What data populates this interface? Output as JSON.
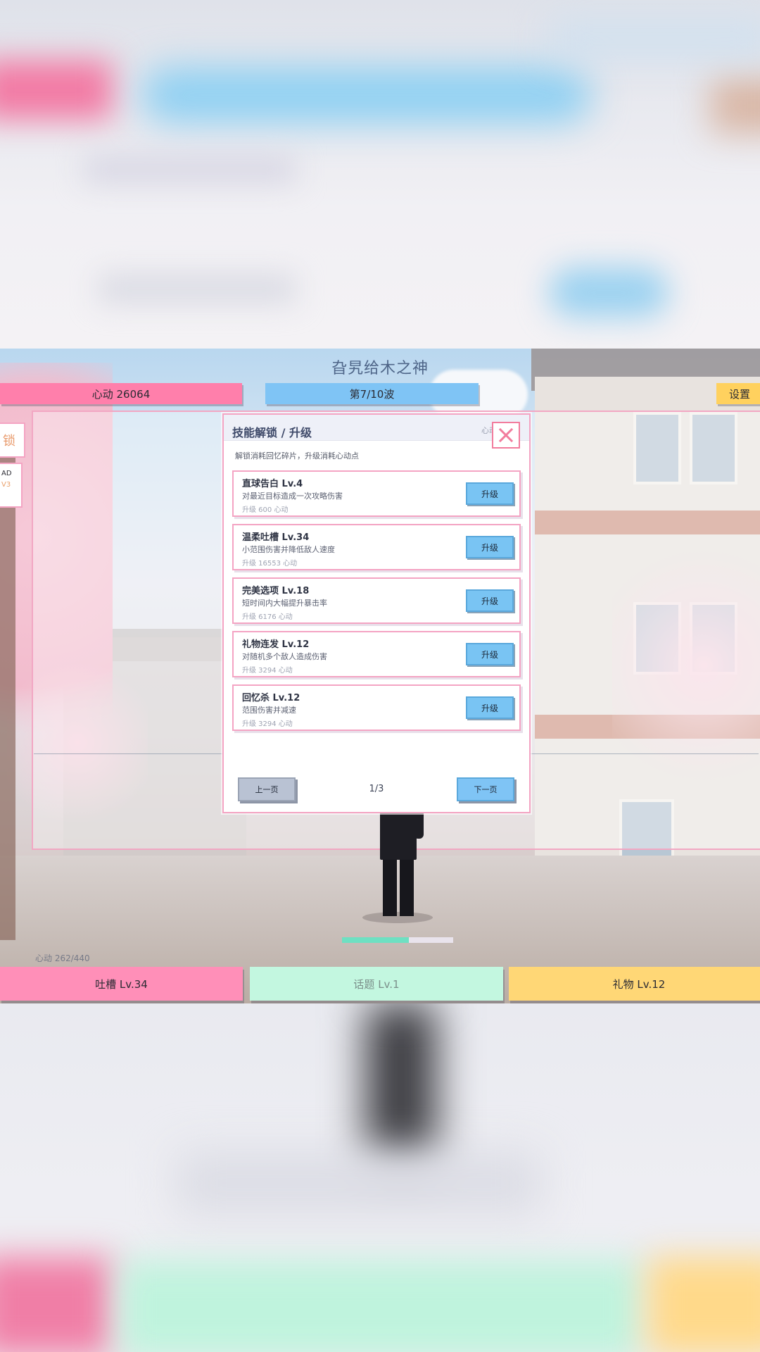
{
  "game": {
    "title": "旮旯给木之神",
    "heart_bar": "心动 26064",
    "wave_bar": "第7/10波",
    "settings_label": "设置",
    "side_tab_label": "锁",
    "side_card_line1": "AD",
    "side_card_line2": "V3",
    "hp_text": "心动 262/440",
    "wave_progress": 0.6,
    "bottom_tabs": {
      "tucao": "吐槽 Lv.34",
      "topic": "话题 Lv.1",
      "gift": "礼物 Lv.12"
    }
  },
  "dialog": {
    "title": "技能解锁 / 升级",
    "hint": "心动",
    "subtitle": "解锁消耗回忆碎片，升级消耗心动点",
    "upgrade_label": "升级",
    "skills": [
      {
        "name": "直球告白 Lv.4",
        "desc": "对最近目标造成一次攻略伤害",
        "cost": "升级 600 心动"
      },
      {
        "name": "温柔吐槽 Lv.34",
        "desc": "小范围伤害并降低敌人速度",
        "cost": "升级 16553 心动"
      },
      {
        "name": "完美选项 Lv.18",
        "desc": "短时间内大幅提升暴击率",
        "cost": "升级 6176 心动"
      },
      {
        "name": "礼物连发 Lv.12",
        "desc": "对随机多个敌人造成伤害",
        "cost": "升级 3294 心动"
      },
      {
        "name": "回忆杀 Lv.12",
        "desc": "范围伤害并减速",
        "cost": "升级 3294 心动"
      }
    ],
    "prev_label": "上一页",
    "next_label": "下一页",
    "page_indicator": "1/3"
  },
  "colors": {
    "heart": "#ff7fab",
    "wave": "#7fc4f5",
    "settings": "#ffd15e",
    "dialog_border": "#f4a4c3",
    "upgrade_button": "#79c4f3",
    "close_x": "#f27c9d"
  },
  "icons": {
    "close": "close-icon"
  }
}
